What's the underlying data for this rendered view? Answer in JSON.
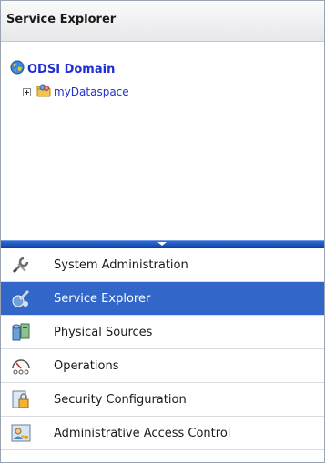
{
  "header": {
    "title": "Service Explorer"
  },
  "tree": {
    "root": {
      "label": "ODSI Domain",
      "icon": "globe-icon"
    },
    "children": [
      {
        "label": "myDataspace",
        "icon": "dataspace-icon",
        "expanded": false
      }
    ]
  },
  "nav": {
    "selected_index": 1,
    "items": [
      {
        "label": "System Administration",
        "icon": "wrench-icon"
      },
      {
        "label": "Service Explorer",
        "icon": "service-explorer-icon"
      },
      {
        "label": "Physical Sources",
        "icon": "database-icon"
      },
      {
        "label": "Operations",
        "icon": "gauge-icon"
      },
      {
        "label": "Security Configuration",
        "icon": "lock-icon"
      },
      {
        "label": "Administrative Access Control",
        "icon": "user-key-icon"
      }
    ]
  },
  "colors": {
    "selected_bg": "#3267c9",
    "tree_link": "#1f2fd0",
    "splitter": "#1a4fb3"
  }
}
